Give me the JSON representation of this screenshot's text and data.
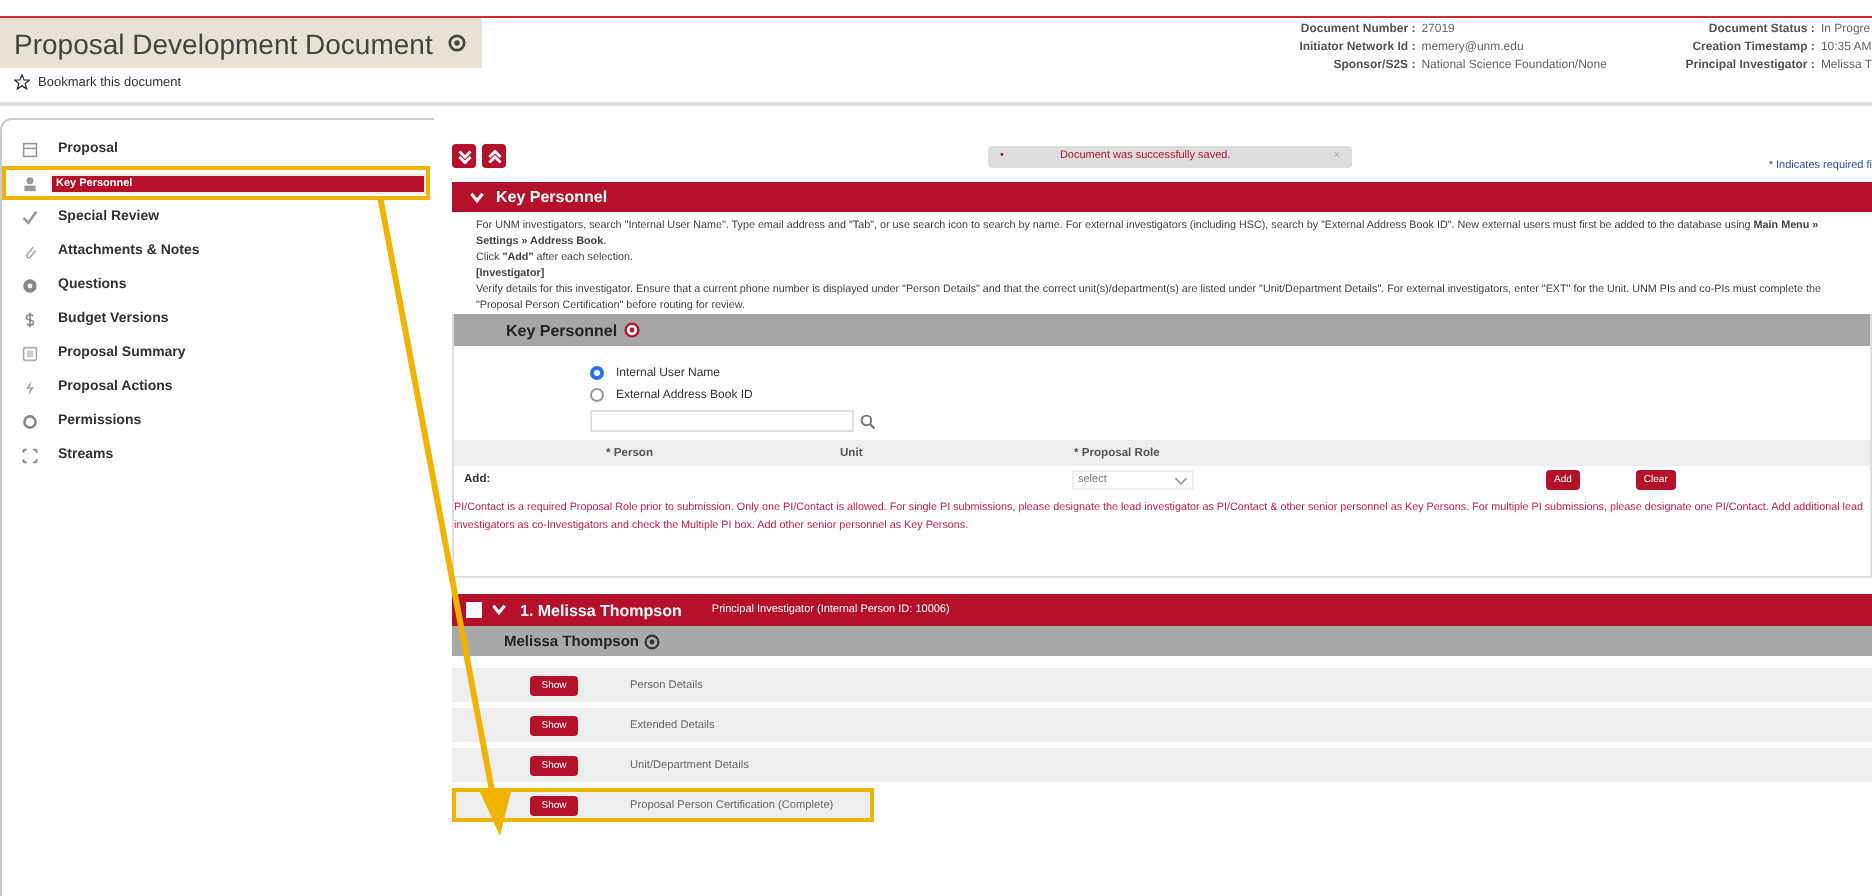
{
  "document": {
    "title": "Proposal Development Document",
    "bookmark": "Bookmark this document",
    "info": [
      {
        "label": "Document Number :",
        "value": "27019"
      },
      {
        "label": "Initiator Network Id :",
        "value": "memery@unm.edu"
      },
      {
        "label": "Sponsor/S2S :",
        "value": "National Science Foundation/None"
      },
      {
        "label": "Document Status :",
        "value": "In Progre"
      },
      {
        "label": "Creation Timestamp :",
        "value": "10:35 AM"
      },
      {
        "label": "Principal Investigator :",
        "value": "Melissa T"
      }
    ]
  },
  "sidebar": {
    "items": [
      {
        "label": "Proposal",
        "selected": false,
        "highlighted": false
      },
      {
        "label": "Key Personnel",
        "selected": true,
        "highlighted": true
      },
      {
        "label": "Special Review",
        "selected": false,
        "highlighted": false
      },
      {
        "label": "Attachments & Notes",
        "selected": false,
        "highlighted": false
      },
      {
        "label": "Questions",
        "selected": false,
        "highlighted": false
      },
      {
        "label": "Budget Versions",
        "selected": false,
        "highlighted": false
      },
      {
        "label": "Proposal Summary",
        "selected": false,
        "highlighted": false
      },
      {
        "label": "Proposal Actions",
        "selected": false,
        "highlighted": false
      },
      {
        "label": "Permissions",
        "selected": false,
        "highlighted": false
      },
      {
        "label": "Streams",
        "selected": false,
        "highlighted": false
      }
    ]
  },
  "message": {
    "text": "Document was successfully saved.",
    "bullet": "•",
    "close": "×"
  },
  "required_note": "* Indicates required fi",
  "section": {
    "title": "Key Personnel",
    "instructions": [
      "For UNM investigators, search \"Internal User Name\". Type email address and \"Tab\", or use search icon to search by name. For external investigators (including HSC), search by \"External Address Book ID\". New external users must first be added to the database using **Main Menu » Settings » Address Book**.",
      "Click **\"Add\"** after each selection.",
      "**[Investigator]**",
      "Verify details for this investigator. Ensure that a current phone number is displayed under \"Person Details\" and that the correct unit(s)/department(s) are listed under \"Unit/Department Details\". For external investigators, enter \"EXT\" for the Unit. UNM PIs and co-PIs must complete the \"Proposal Person Certification\" before routing for review."
    ],
    "subtitle": "Key Personnel",
    "search_options": [
      {
        "label": "Internal User Name",
        "selected": true
      },
      {
        "label": "External Address Book ID",
        "selected": false
      }
    ],
    "columns": [
      "* Person",
      "Unit",
      "* Proposal Role"
    ],
    "add_label": "Add:",
    "role_select": "select",
    "add_button": "Add",
    "clear_button": "Clear",
    "warning": "PI/Contact is a required Proposal Role prior to submission. Only one PI/Contact is allowed. For single PI submissions, please designate the lead investigator as PI/Contact & other senior personnel as Key Persons. For multiple PI submissions, please designate one PI/Contact. Add additional lead investigators as co-Investigators and check the Multiple PI box. Add other senior personnel as Key Persons."
  },
  "person": {
    "checked": false,
    "title": "1. Melissa Thompson",
    "role": "Principal Investigator (Internal Person ID: 10006)",
    "name": "Melissa Thompson",
    "details": [
      {
        "button": "Show",
        "label": "Person Details",
        "highlighted": false
      },
      {
        "button": "Show",
        "label": "Extended Details",
        "highlighted": false
      },
      {
        "button": "Show",
        "label": "Unit/Department Details",
        "highlighted": false
      },
      {
        "button": "Show",
        "label": "Proposal Person Certification (Complete)",
        "highlighted": true
      }
    ]
  }
}
